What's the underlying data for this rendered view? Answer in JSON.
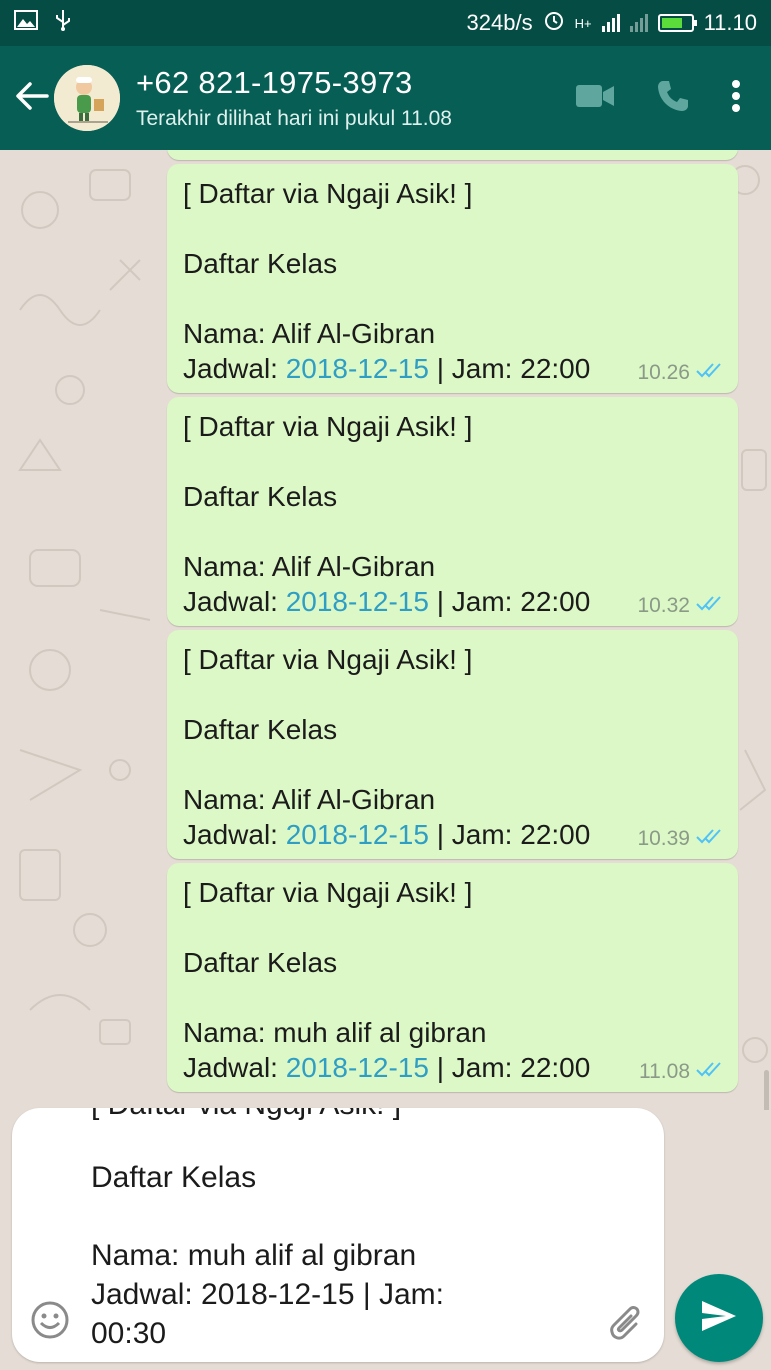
{
  "status_bar": {
    "net_speed": "324b/s",
    "network_type": "H+",
    "time": "11.10",
    "icons": [
      "image-icon",
      "usb-icon",
      "alarm-icon",
      "signal-icon",
      "battery-icon"
    ]
  },
  "header": {
    "contact_name": "+62 821-1975-3973",
    "last_seen": "Terakhir dilihat hari ini pukul 11.08",
    "icons": [
      "back-arrow-icon",
      "video-call-icon",
      "phone-icon",
      "more-vert-icon"
    ]
  },
  "messages": [
    {
      "title": "[ Daftar via Ngaji Asik! ]",
      "subtitle": "Daftar Kelas",
      "nama": "Nama: Alif Al-Gibran",
      "jadwal_label": "Jadwal: ",
      "jadwal_date": "2018-12-15",
      "jam": " | Jam: 22:00",
      "time": "10.26"
    },
    {
      "title": "[ Daftar via Ngaji Asik! ]",
      "subtitle": "Daftar Kelas",
      "nama": "Nama: Alif Al-Gibran",
      "jadwal_label": "Jadwal: ",
      "jadwal_date": "2018-12-15",
      "jam": " | Jam: 22:00",
      "time": "10.32"
    },
    {
      "title": "[ Daftar via Ngaji Asik! ]",
      "subtitle": "Daftar Kelas",
      "nama": "Nama: Alif Al-Gibran",
      "jadwal_label": "Jadwal: ",
      "jadwal_date": "2018-12-15",
      "jam": " | Jam: 22:00",
      "time": "10.39"
    },
    {
      "title": "[ Daftar via Ngaji Asik! ]",
      "subtitle": "Daftar Kelas",
      "nama": "Nama: muh alif al gibran",
      "jadwal_label": "Jadwal: ",
      "jadwal_date": "2018-12-15",
      "jam": " | Jam: 22:00",
      "time": "11.08"
    }
  ],
  "composer": {
    "cut_line": "[ Daftar via Ngaji Asik! ]",
    "line1": "Daftar Kelas",
    "line2": "Nama: muh alif al gibran",
    "line3": "Jadwal: 2018-12-15 | Jam:",
    "line4": "00:30"
  },
  "colors": {
    "header": "#075e54",
    "status_bar": "#054d44",
    "bubble_out": "#dcf8c6",
    "link": "#2f9ec5",
    "read_ticks": "#4fc3f7",
    "send_button": "#00897b"
  }
}
